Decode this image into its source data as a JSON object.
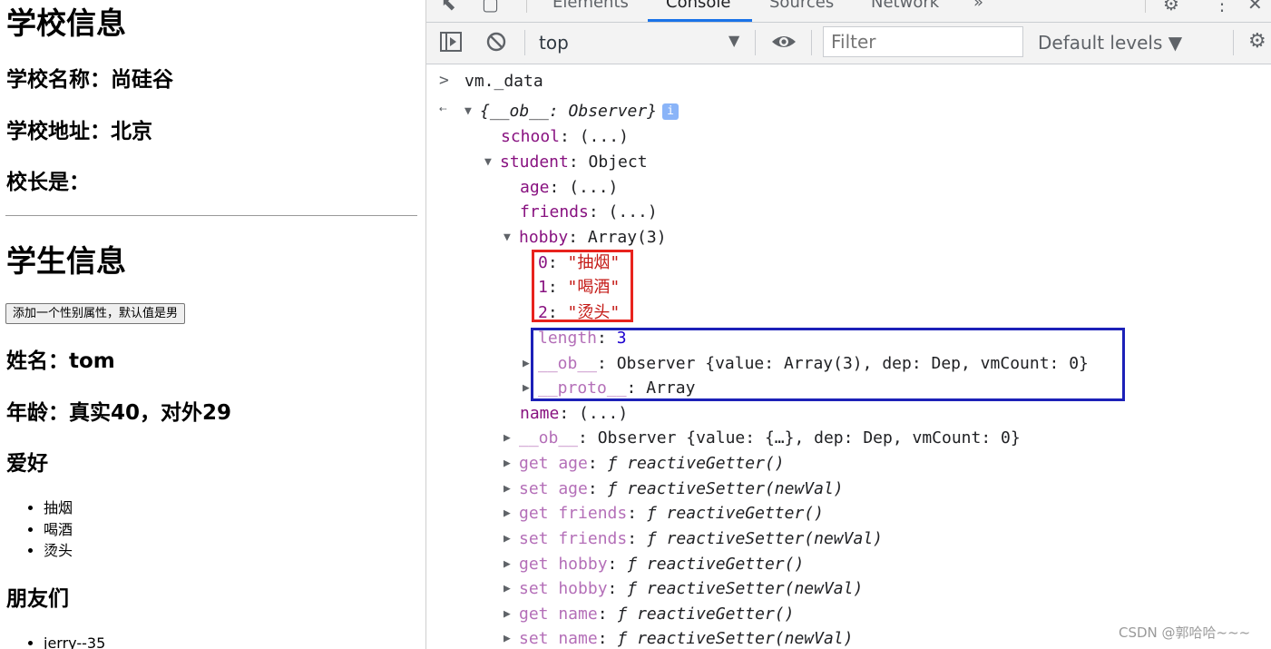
{
  "page": {
    "school_heading": "学校信息",
    "school_name": "学校名称：尚硅谷",
    "school_address": "学校地址：北京",
    "principal": "校长是：",
    "student_heading": "学生信息",
    "add_button": "添加一个性别属性，默认值是男",
    "student_name": "姓名：tom",
    "student_age": "年龄：真实40，对外29",
    "hobby_heading": "爱好",
    "hobbies": [
      "抽烟",
      "喝酒",
      "烫头"
    ],
    "friends_heading": "朋友们",
    "friends": [
      "jerry--35"
    ]
  },
  "devtools": {
    "tabs": [
      "Elements",
      "Console",
      "Sources",
      "Network",
      "»"
    ],
    "active_tab": "Console",
    "context": "top",
    "filter_placeholder": "Filter",
    "levels": "Default levels ▼",
    "icons": [
      "inspect-icon",
      "device-toggle-icon",
      "settings-icon",
      "more-menu-icon",
      "close-icon",
      "sidebar-toggle-icon",
      "clear-console-icon",
      "eye-icon"
    ]
  },
  "console": {
    "input": "vm._data",
    "lines": [
      {
        "key": "school",
        "sep": ": ",
        "val": "(...)"
      },
      {
        "key": "student",
        "sep": ": ",
        "val": "Object"
      },
      {
        "key": "age",
        "sep": ": ",
        "val": "(...)"
      },
      {
        "key": "friends",
        "sep": ": ",
        "val": "(...)"
      },
      {
        "key": "hobby",
        "sep": ": ",
        "val": "Array(3)"
      },
      {
        "key": "0",
        "sep": ": ",
        "val": "\"抽烟\""
      },
      {
        "key": "1",
        "sep": ": ",
        "val": "\"喝酒\""
      },
      {
        "key": "2",
        "sep": ": ",
        "val": "\"烫头\""
      },
      {
        "key": "length",
        "sep": ": ",
        "val": "3"
      },
      {
        "key": "__ob__",
        "sep": ": ",
        "val": "Observer {value: Array(3), dep: Dep, vmCount: 0}"
      },
      {
        "key": "__proto__",
        "sep": ": ",
        "val": "Array"
      },
      {
        "key": "name",
        "sep": ": ",
        "val": "(...)"
      },
      {
        "key": "__ob__",
        "sep": ": ",
        "val": "Observer {value: {…}, dep: Dep, vmCount: 0}"
      },
      {
        "key": "get age",
        "sep": ": ",
        "val": "ƒ reactiveGetter()"
      },
      {
        "key": "set age",
        "sep": ": ",
        "val": "ƒ reactiveSetter(newVal)"
      },
      {
        "key": "get friends",
        "sep": ": ",
        "val": "ƒ reactiveGetter()"
      },
      {
        "key": "set friends",
        "sep": ": ",
        "val": "ƒ reactiveSetter(newVal)"
      },
      {
        "key": "get hobby",
        "sep": ": ",
        "val": "ƒ reactiveGetter()"
      },
      {
        "key": "set hobby",
        "sep": ": ",
        "val": "ƒ reactiveSetter(newVal)"
      },
      {
        "key": "get name",
        "sep": ": ",
        "val": "ƒ reactiveGetter()"
      },
      {
        "key": "set name",
        "sep": ": ",
        "val": "ƒ reactiveSetter(newVal)"
      }
    ],
    "result_root": "{__ob__: Observer}"
  },
  "watermark": "CSDN @郭哈哈~~~",
  "colors": {
    "red_box": "#e8231d",
    "blue_box": "#1c21b8",
    "accent": "#1a73e8"
  }
}
